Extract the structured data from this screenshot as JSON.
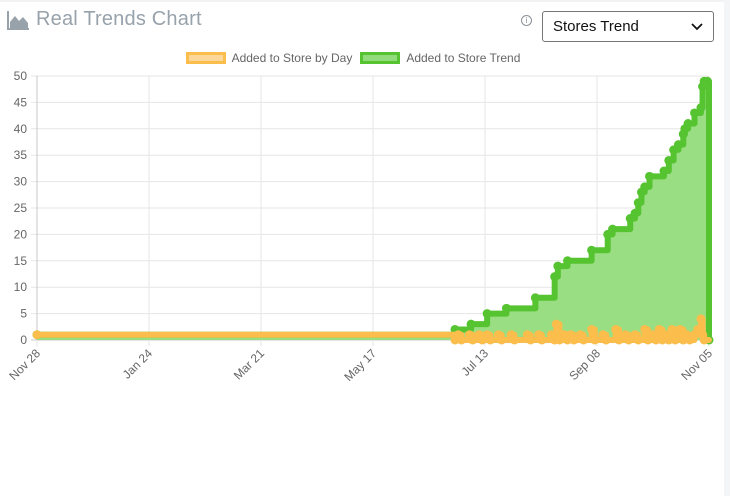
{
  "header": {
    "title": "Real Trends Chart",
    "logo_icon": "area-chart-icon",
    "info_icon": "info-icon"
  },
  "trend_select": {
    "selected": "Stores Trend"
  },
  "chart_data": {
    "type": "line",
    "title": "Real Trends Chart",
    "ylim": [
      0,
      50
    ],
    "yticks": [
      0,
      5,
      10,
      15,
      20,
      25,
      30,
      35,
      40,
      45,
      50
    ],
    "xticks": [
      "Nov 28",
      "Jan 24",
      "Mar 21",
      "May 17",
      "Jul 13",
      "Sep 08",
      "Nov 05"
    ],
    "grid": true,
    "legend_position": "top",
    "series": [
      {
        "name": "Added to Store by Day",
        "color": "#fbbd4c",
        "fill": false,
        "points": [
          [
            0,
            1
          ],
          [
            260,
            0
          ],
          [
            262,
            1
          ],
          [
            264,
            0
          ],
          [
            269,
            1
          ],
          [
            271,
            0
          ],
          [
            275,
            1
          ],
          [
            277,
            0
          ],
          [
            280,
            1
          ],
          [
            282,
            0
          ],
          [
            287,
            1
          ],
          [
            289,
            0
          ],
          [
            295,
            1
          ],
          [
            297,
            0
          ],
          [
            305,
            1
          ],
          [
            307,
            0
          ],
          [
            312,
            1
          ],
          [
            314,
            0
          ],
          [
            320,
            1
          ],
          [
            322,
            0
          ],
          [
            323,
            3
          ],
          [
            325,
            0
          ],
          [
            328,
            1
          ],
          [
            330,
            0
          ],
          [
            332,
            1
          ],
          [
            334,
            0
          ],
          [
            338,
            1
          ],
          [
            340,
            0
          ],
          [
            345,
            2
          ],
          [
            347,
            0
          ],
          [
            352,
            1
          ],
          [
            354,
            0
          ],
          [
            360,
            2
          ],
          [
            362,
            0
          ],
          [
            366,
            1
          ],
          [
            368,
            0
          ],
          [
            372,
            1
          ],
          [
            374,
            0
          ],
          [
            378,
            2
          ],
          [
            380,
            0
          ],
          [
            383,
            1
          ],
          [
            385,
            0
          ],
          [
            387,
            2
          ],
          [
            389,
            0
          ],
          [
            391,
            1
          ],
          [
            393,
            0
          ],
          [
            395,
            2
          ],
          [
            397,
            0
          ],
          [
            400,
            2
          ],
          [
            402,
            0
          ],
          [
            404,
            1
          ],
          [
            406,
            0
          ],
          [
            409,
            1
          ],
          [
            411,
            2
          ],
          [
            413,
            4
          ],
          [
            414,
            1
          ],
          [
            415,
            0
          ]
        ]
      },
      {
        "name": "Added to Store Trend",
        "color": "#56c431",
        "fill": true,
        "fill_color": "#93dc7b",
        "points": [
          [
            0,
            1
          ],
          [
            260,
            2
          ],
          [
            270,
            3
          ],
          [
            280,
            5
          ],
          [
            292,
            6
          ],
          [
            310,
            8
          ],
          [
            322,
            12
          ],
          [
            324,
            14
          ],
          [
            330,
            15
          ],
          [
            345,
            17
          ],
          [
            355,
            20
          ],
          [
            358,
            21
          ],
          [
            369,
            23
          ],
          [
            372,
            24
          ],
          [
            374,
            26
          ],
          [
            376,
            28
          ],
          [
            378,
            29
          ],
          [
            381,
            31
          ],
          [
            390,
            32
          ],
          [
            393,
            34
          ],
          [
            396,
            36
          ],
          [
            399,
            37
          ],
          [
            402,
            39
          ],
          [
            403,
            40
          ],
          [
            405,
            41
          ],
          [
            409,
            43
          ],
          [
            413,
            44
          ],
          [
            414,
            48
          ],
          [
            415,
            49
          ],
          [
            417,
            49
          ],
          [
            418,
            0
          ]
        ]
      }
    ]
  }
}
